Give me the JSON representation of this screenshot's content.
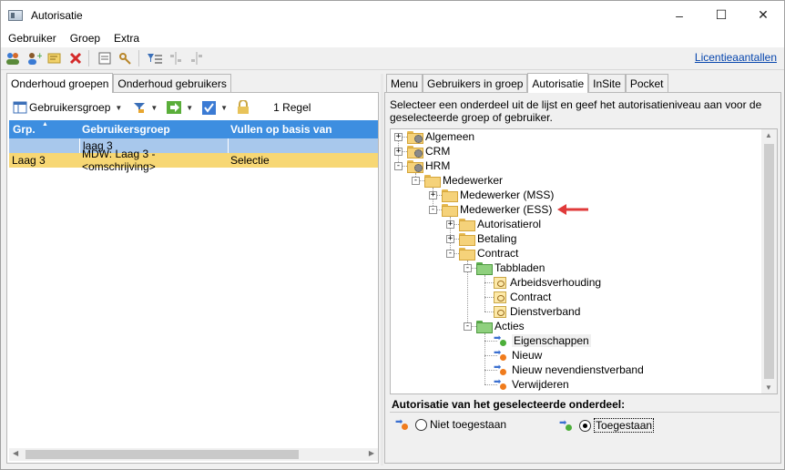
{
  "window": {
    "title": "Autorisatie",
    "minimize": "–",
    "maximize": "☐",
    "close": "✕"
  },
  "menu": [
    "Gebruiker",
    "Groep",
    "Extra"
  ],
  "toolbar": {
    "license_link": "Licentieaantallen"
  },
  "left": {
    "tabs": [
      "Onderhoud groepen",
      "Onderhoud gebruikers"
    ],
    "active_tab": 0,
    "toolbar": {
      "group_button": "Gebruikersgroep",
      "count": "1 Regel"
    },
    "grid": {
      "columns": [
        "Grp.",
        "Gebruikersgroep",
        "Vullen op basis van"
      ],
      "filter": [
        "",
        "laag 3",
        ""
      ],
      "rows": [
        [
          "Laag 3",
          "MDW: Laag 3 - <omschrijving>",
          "Selectie"
        ]
      ]
    }
  },
  "right": {
    "tabs": [
      "Menu",
      "Gebruikers in groep",
      "Autorisatie",
      "InSite",
      "Pocket"
    ],
    "active_tab": 2,
    "instructions": "Selecteer een onderdeel uit de lijst en geef het autorisatieniveau aan voor de geselecteerde groep of gebruiker.",
    "tree": [
      {
        "label": "Algemeen",
        "level": 0,
        "icon": "gear-folder-icon",
        "expander": "+"
      },
      {
        "label": "CRM",
        "level": 0,
        "icon": "gear-folder-icon",
        "expander": "+"
      },
      {
        "label": "HRM",
        "level": 0,
        "icon": "gear-folder-icon",
        "expander": "−"
      },
      {
        "label": "Medewerker",
        "level": 1,
        "icon": "folder-icon",
        "expander": "−"
      },
      {
        "label": "Medewerker (MSS)",
        "level": 2,
        "icon": "folder-icon",
        "expander": "+"
      },
      {
        "label": "Medewerker (ESS)",
        "level": 2,
        "icon": "folder-icon",
        "expander": "−"
      },
      {
        "label": "Autorisatierol",
        "level": 3,
        "icon": "folder-icon",
        "expander": "+"
      },
      {
        "label": "Betaling",
        "level": 3,
        "icon": "folder-icon",
        "expander": "+"
      },
      {
        "label": "Contract",
        "level": 3,
        "icon": "folder-icon",
        "expander": "−"
      },
      {
        "label": "Tabbladen",
        "level": 4,
        "icon": "green-folder-icon",
        "expander": "−"
      },
      {
        "label": "Arbeidsverhouding",
        "level": 5,
        "icon": "document-icon",
        "expander": ""
      },
      {
        "label": "Contract",
        "level": 5,
        "icon": "document-icon",
        "expander": ""
      },
      {
        "label": "Dienstverband",
        "level": 5,
        "icon": "document-icon",
        "expander": ""
      },
      {
        "label": "Acties",
        "level": 4,
        "icon": "green-folder-icon",
        "expander": "−"
      },
      {
        "label": "Eigenschappen",
        "level": 5,
        "icon": "action-allowed-icon",
        "expander": "",
        "selected": true
      },
      {
        "label": "Nieuw",
        "level": 5,
        "icon": "action-denied-icon",
        "expander": ""
      },
      {
        "label": "Nieuw nevendienstverband",
        "level": 5,
        "icon": "action-denied-icon",
        "expander": ""
      },
      {
        "label": "Verwijderen",
        "level": 5,
        "icon": "action-denied-icon",
        "expander": ""
      }
    ],
    "auth_title": "Autorisatie van het geselecteerde onderdeel:",
    "options": [
      {
        "label": "Niet toegestaan",
        "checked": false
      },
      {
        "label": "Toegestaan",
        "checked": true
      }
    ]
  },
  "colors": {
    "header_blue": "#3d8ee0",
    "filter_blue": "#a8c8ec",
    "row_yellow": "#f7d774",
    "annotation_red": "#e03a3a"
  }
}
